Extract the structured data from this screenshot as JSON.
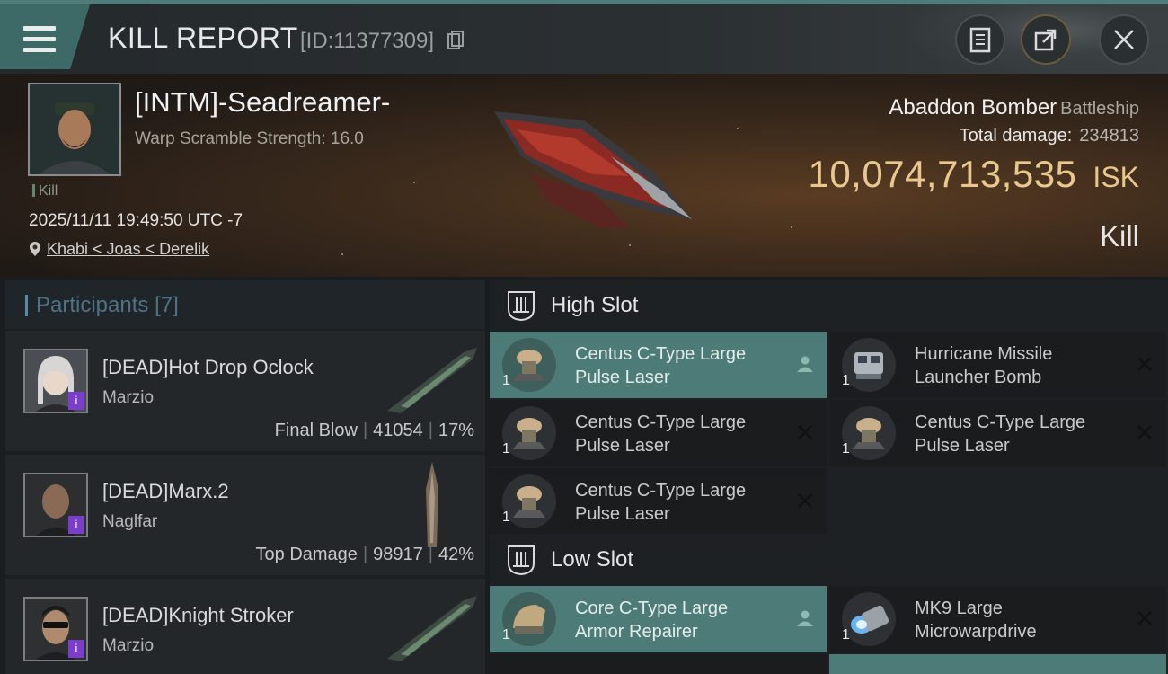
{
  "header": {
    "title": "KILL REPORT",
    "report_id": "[ID:11377309]"
  },
  "victim": {
    "name": "[INTM]-Seadreamer-",
    "warp_scramble": "Warp Scramble Strength: 16.0",
    "tag": "Kill",
    "datetime": "2025/11/11 19:49:50 UTC -7",
    "location": "Khabi < Joas < Derelik",
    "ship_name": "Abaddon Bomber",
    "ship_class": "Battleship",
    "total_damage_label": "Total damage:",
    "total_damage_value": "234813",
    "isk_amount": "10,074,713,535",
    "isk_unit": "ISK",
    "status": "Kill"
  },
  "participants": {
    "title": "Participants",
    "count": "[7]",
    "items": [
      {
        "name": "[DEAD]Hot Drop Oclock",
        "ship": "Marzio",
        "stat_label": "Final Blow",
        "damage": "41054",
        "percent": "17%"
      },
      {
        "name": "[DEAD]Marx.2",
        "ship": "Naglfar",
        "stat_label": "Top Damage",
        "damage": "98917",
        "percent": "42%"
      },
      {
        "name": "[DEAD]Knight Stroker",
        "ship": "Marzio",
        "stat_label": "",
        "damage": "",
        "percent": ""
      }
    ]
  },
  "fitting": {
    "high_slot": {
      "title": "High Slot",
      "modules": [
        {
          "name_line1": "Centus C-Type Large",
          "name_line2": "Pulse Laser",
          "qty": "1",
          "icon": "pulse-laser-icon",
          "action": "person-icon"
        },
        {
          "name_line1": "Hurricane Missile",
          "name_line2": "Launcher Bomb",
          "qty": "1",
          "icon": "missile-launcher-icon",
          "action": "close-icon"
        },
        {
          "name_line1": "Centus C-Type Large",
          "name_line2": "Pulse Laser",
          "qty": "1",
          "icon": "pulse-laser-icon",
          "action": "close-icon"
        },
        {
          "name_line1": "Centus C-Type Large",
          "name_line2": "Pulse Laser",
          "qty": "1",
          "icon": "pulse-laser-icon",
          "action": "close-icon"
        },
        {
          "name_line1": "Centus C-Type Large",
          "name_line2": "Pulse Laser",
          "qty": "1",
          "icon": "pulse-laser-icon",
          "action": "close-icon"
        }
      ]
    },
    "low_slot": {
      "title": "Low Slot",
      "modules": [
        {
          "name_line1": "Core C-Type Large",
          "name_line2": "Armor Repairer",
          "qty": "1",
          "icon": "armor-repairer-icon",
          "action": "person-icon"
        },
        {
          "name_line1": "MK9 Large",
          "name_line2": "Microwarpdrive",
          "qty": "1",
          "icon": "microwarpdrive-icon",
          "action": "close-icon"
        }
      ]
    }
  },
  "colors": {
    "accent_teal": "#4d7c78",
    "isk_gold": "#e8c88c",
    "badge_purple": "#7a3fc8"
  }
}
